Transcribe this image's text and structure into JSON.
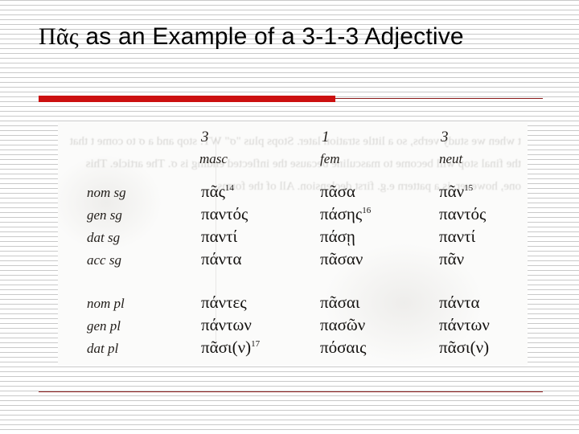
{
  "slide": {
    "title_greek": "Πᾶς",
    "title_rest": " as an Example of a 3-1-3 Adjective",
    "accent_color": "#cc1010",
    "rule_color": "#8b1a1a"
  },
  "paradigm": {
    "row_label_header": "",
    "columns": [
      {
        "number": "3",
        "gender": "masc"
      },
      {
        "number": "1",
        "gender": "fem"
      },
      {
        "number": "3",
        "gender": "neut"
      }
    ],
    "rows": [
      {
        "case_label": "nom sg",
        "masc": "πᾶς",
        "masc_note": "14",
        "fem": "πᾶσα",
        "fem_note": "",
        "neut": "πᾶν",
        "neut_note": "15"
      },
      {
        "case_label": "gen sg",
        "masc": "παντός",
        "masc_note": "",
        "fem": "πάσης",
        "fem_note": "16",
        "neut": "παντός",
        "neut_note": ""
      },
      {
        "case_label": "dat sg",
        "masc": "παντί",
        "masc_note": "",
        "fem": "πάσῃ",
        "fem_note": "",
        "neut": "παντί",
        "neut_note": ""
      },
      {
        "case_label": "acc sg",
        "masc": "πάντα",
        "masc_note": "",
        "fem": "πᾶσαν",
        "fem_note": "",
        "neut": "πᾶν",
        "neut_note": ""
      },
      {
        "case_label": "nom pl",
        "masc": "πάντες",
        "masc_note": "",
        "fem": "πᾶσαι",
        "fem_note": "",
        "neut": "πάντα",
        "neut_note": ""
      },
      {
        "case_label": "gen pl",
        "masc": "πάντων",
        "masc_note": "",
        "fem": "πασῶν",
        "fem_note": "",
        "neut": "πάντων",
        "neut_note": ""
      },
      {
        "case_label": "dat pl",
        "masc": "πᾶσι(ν)",
        "masc_note": "17",
        "fem": "πόσαις",
        "fem_note": "",
        "neut": "πᾶσι(ν)",
        "neut_note": ""
      }
    ],
    "bleed_through_text": "t when we study verbs, so a little stration later. Stops plus \"σ\" WT: stop and a σ to come t that the final stop will become to masculine because the inflected ending is σ. The article. This one, however, is a pattern e.g. first declension. All of the forms"
  }
}
